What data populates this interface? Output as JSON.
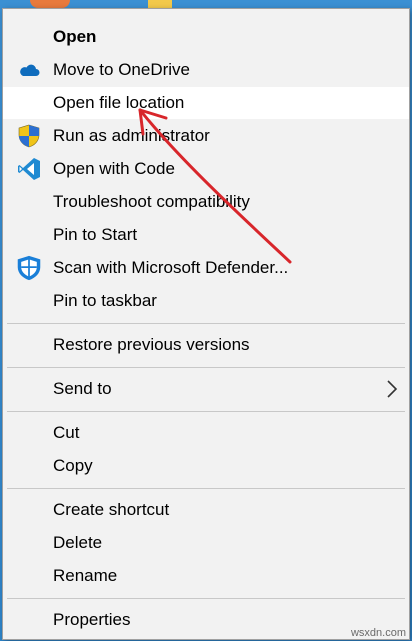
{
  "menu": {
    "items": [
      {
        "label": "Open",
        "bold": true
      },
      {
        "label": "Move to OneDrive",
        "icon": "onedrive-cloud-icon"
      },
      {
        "label": "Open file location",
        "highlighted": true
      },
      {
        "label": "Run as administrator",
        "icon": "uac-shield-icon"
      },
      {
        "label": "Open with Code",
        "icon": "vscode-icon"
      },
      {
        "label": "Troubleshoot compatibility"
      },
      {
        "label": "Pin to Start"
      },
      {
        "label": "Scan with Microsoft Defender...",
        "icon": "defender-shield-icon"
      },
      {
        "label": "Pin to taskbar"
      },
      {
        "label": "Restore previous versions"
      },
      {
        "label": "Send to",
        "submenu": true
      },
      {
        "label": "Cut"
      },
      {
        "label": "Copy"
      },
      {
        "label": "Create shortcut"
      },
      {
        "label": "Delete"
      },
      {
        "label": "Rename"
      },
      {
        "label": "Properties"
      }
    ]
  },
  "colors": {
    "menu_bg": "#f2f2f2",
    "hover_bg": "#ffffff",
    "annotation_arrow": "#d8262b",
    "onedrive_blue": "#0f6cbd",
    "vscode_blue": "#1f8ad2",
    "defender_blue": "#1a7fd8"
  },
  "watermark": "wsxdn.com"
}
